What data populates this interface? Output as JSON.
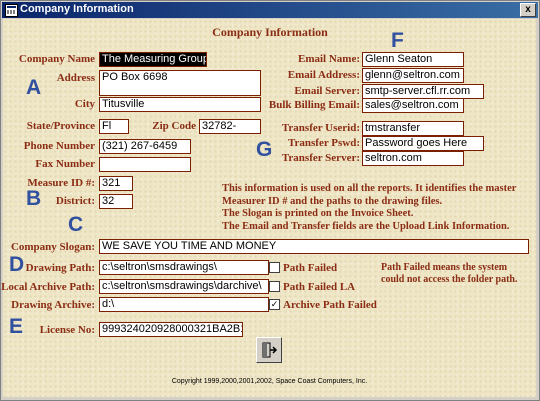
{
  "window": {
    "title": "Company Information",
    "close_label": "x"
  },
  "form": {
    "heading": "Company Information",
    "markers": {
      "a": "A",
      "b": "B",
      "c": "C",
      "d": "D",
      "e": "E",
      "f": "F",
      "g": "G"
    },
    "company_name": {
      "label": "Company Name",
      "value": "The Measuring Group"
    },
    "address": {
      "label": "Address",
      "value": "PO Box 6698"
    },
    "city": {
      "label": "City",
      "value": "Titusville"
    },
    "state": {
      "label": "State/Province",
      "value": "Fl"
    },
    "zip": {
      "label": "Zip Code",
      "value": "32782-"
    },
    "phone": {
      "label": "Phone Number",
      "value": "(321) 267-6459"
    },
    "fax": {
      "label": "Fax Number",
      "value": ""
    },
    "measure_id": {
      "label": "Measure ID #:",
      "value": "321"
    },
    "district": {
      "label": "District:",
      "value": "32"
    },
    "email_name": {
      "label": "Email Name:",
      "value": "Glenn Seaton"
    },
    "email_address": {
      "label": "Email Address:",
      "value": "glenn@seltron.com"
    },
    "email_server": {
      "label": "Email Server:",
      "value": "smtp-server.cfl.rr.com"
    },
    "bulk_billing": {
      "label": "Bulk Billing Email:",
      "value": "sales@seltron.com"
    },
    "transfer_userid": {
      "label": "Transfer Userid:",
      "value": "tmstransfer"
    },
    "transfer_pswd": {
      "label": "Transfer Pswd:",
      "value": "Password goes Here"
    },
    "transfer_server": {
      "label": "Transfer Server:",
      "value": "seltron.com"
    },
    "info_lines": [
      "This information is used on all the reports. It identifies the master",
      "Measurer ID # and  the paths to the drawing files.",
      "The Slogan is printed on the Invoice Sheet.",
      "The Email and Transfer fields are the Upload Link Information."
    ],
    "slogan": {
      "label": "Company Slogan:",
      "value": "WE SAVE YOU TIME AND MONEY"
    },
    "drawing_path": {
      "label": "Drawing Path:",
      "value": "c:\\seltron\\smsdrawings\\",
      "check_label": "Path Failed",
      "checked": false
    },
    "local_archive": {
      "label": "Local Archive Path:",
      "value": "c:\\seltron\\smsdrawings\\darchive\\",
      "check_label": "Path Failed LA",
      "checked": false
    },
    "drawing_archive": {
      "label": "Drawing Archive:",
      "value": "d:\\",
      "check_label": "Archive Path Failed",
      "checked": true,
      "check_mark": "✓"
    },
    "path_note": "Path Failed means the system could not access the folder path.",
    "license": {
      "label": "License No:",
      "value": "999324020928000321BA2B15"
    },
    "copyright": "Copyright 1999,2000,2001,2002, Space Coast Computers, Inc."
  }
}
